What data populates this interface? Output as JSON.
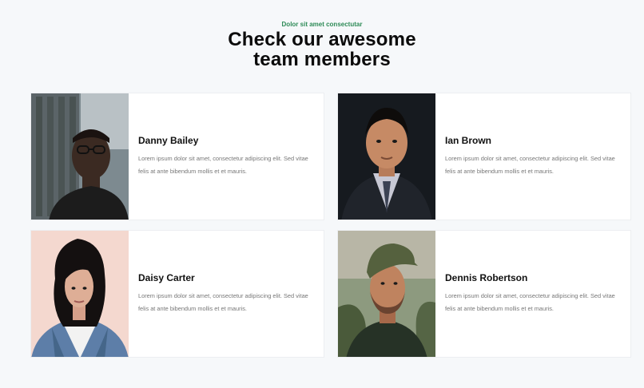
{
  "header": {
    "eyebrow": "Dolor sit amet consectutar",
    "title_line1": "Check our awesome",
    "title_line2": "team members"
  },
  "team": [
    {
      "name": "Danny Bailey",
      "bio": "Lorem ipsum dolor sit amet, consectetur adipiscing elit. Sed vitae felis at ante bibendum mollis et et mauris.",
      "photo": "man-with-glasses-photo"
    },
    {
      "name": "Ian Brown",
      "bio": "Lorem ipsum dolor sit amet, consectetur adipiscing elit. Sed vitae felis at ante bibendum mollis et et mauris.",
      "photo": "man-in-suit-photo"
    },
    {
      "name": "Daisy Carter",
      "bio": "Lorem ipsum dolor sit amet, consectetur adipiscing elit. Sed vitae felis at ante bibendum mollis et et mauris.",
      "photo": "woman-denim-jacket-photo"
    },
    {
      "name": "Dennis Robertson",
      "bio": "Lorem ipsum dolor sit amet, consectetur adipiscing elit. Sed vitae felis at ante bibendum mollis et et mauris.",
      "photo": "man-in-cap-photo"
    }
  ]
}
